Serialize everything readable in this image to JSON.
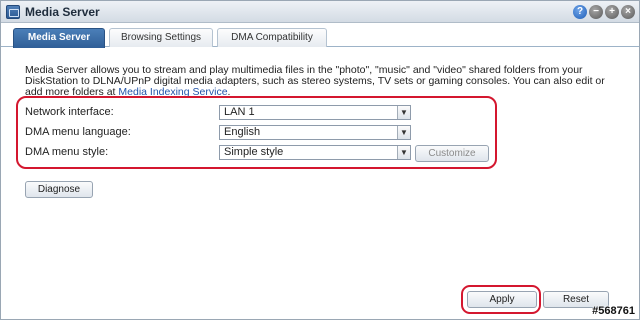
{
  "window": {
    "title": "Media Server",
    "controls": {
      "help": "?",
      "minimize": "−",
      "maximize": "+",
      "close": "×"
    }
  },
  "tabs": [
    {
      "label": "Media Server",
      "active": true
    },
    {
      "label": "Browsing Settings",
      "active": false
    },
    {
      "label": "DMA Compatibility",
      "active": false
    }
  ],
  "description": {
    "text": "Media Server allows you to stream and play multimedia files in the \"photo\", \"music\" and \"video\" shared folders from your DiskStation to DLNA/UPnP digital media adapters, such as stereo systems, TV sets or gaming consoles. You can also edit or add more folders at ",
    "link": "Media Indexing Service",
    "suffix": "."
  },
  "form": {
    "network_interface": {
      "label": "Network interface:",
      "value": "LAN 1"
    },
    "dma_menu_language": {
      "label": "DMA menu language:",
      "value": "English"
    },
    "dma_menu_style": {
      "label": "DMA menu style:",
      "value": "Simple style"
    },
    "customize_label": "Customize",
    "diagnose_label": "Diagnose"
  },
  "footer": {
    "apply_label": "Apply",
    "reset_label": "Reset"
  },
  "watermark": "#568761",
  "colors": {
    "active_tab": "#3b6ea8",
    "highlight": "#d4172f",
    "link": "#2255aa"
  }
}
